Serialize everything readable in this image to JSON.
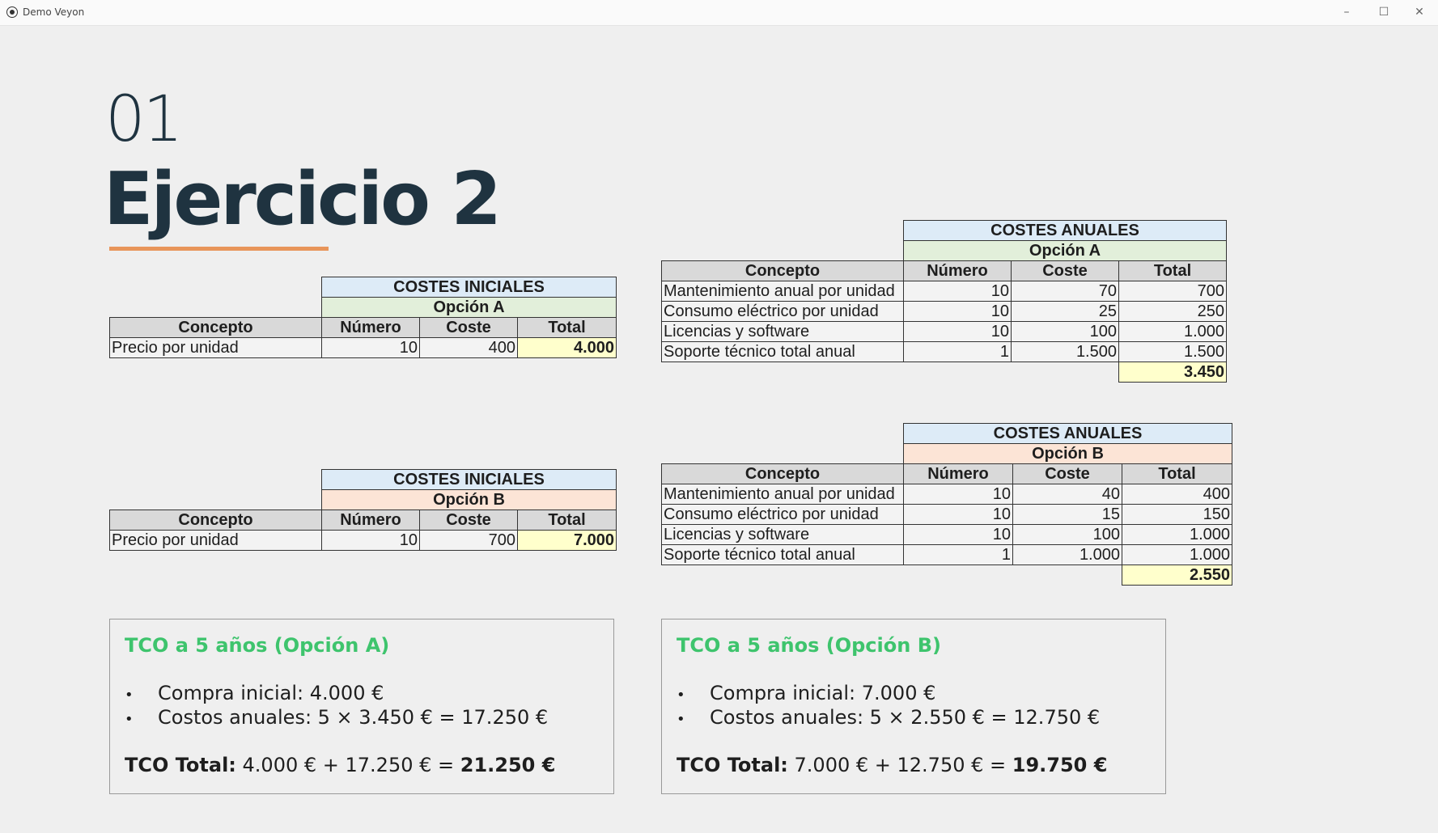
{
  "window": {
    "title": "Demo Veyon",
    "minimize": "–",
    "maximize": "☐",
    "close": "✕"
  },
  "slide": {
    "number": "01",
    "title": "Ejercicio 2"
  },
  "initial_a": {
    "heading": "COSTES INICIALES",
    "option": "Opción A",
    "columns": [
      "Concepto",
      "Número",
      "Coste",
      "Total"
    ],
    "rows": [
      {
        "concept": "Precio por unidad",
        "number": "10",
        "cost": "400",
        "total": "4.000"
      }
    ]
  },
  "initial_b": {
    "heading": "COSTES INICIALES",
    "option": "Opción B",
    "columns": [
      "Concepto",
      "Número",
      "Coste",
      "Total"
    ],
    "rows": [
      {
        "concept": "Precio por unidad",
        "number": "10",
        "cost": "700",
        "total": "7.000"
      }
    ]
  },
  "annual_a": {
    "heading": "COSTES ANUALES",
    "option": "Opción A",
    "columns": [
      "Concepto",
      "Número",
      "Coste",
      "Total"
    ],
    "rows": [
      {
        "concept": "Mantenimiento anual por unidad",
        "number": "10",
        "cost": "70",
        "total": "700"
      },
      {
        "concept": "Consumo eléctrico por unidad",
        "number": "10",
        "cost": "25",
        "total": "250"
      },
      {
        "concept": "Licencias y software",
        "number": "10",
        "cost": "100",
        "total": "1.000"
      },
      {
        "concept": "Soporte técnico total anual",
        "number": "1",
        "cost": "1.500",
        "total": "1.500"
      }
    ],
    "grand_total": "3.450"
  },
  "annual_b": {
    "heading": "COSTES ANUALES",
    "option": "Opción B",
    "columns": [
      "Concepto",
      "Número",
      "Coste",
      "Total"
    ],
    "rows": [
      {
        "concept": "Mantenimiento anual por unidad",
        "number": "10",
        "cost": "40",
        "total": "400"
      },
      {
        "concept": "Consumo eléctrico por unidad",
        "number": "10",
        "cost": "15",
        "total": "150"
      },
      {
        "concept": "Licencias y software",
        "number": "10",
        "cost": "100",
        "total": "1.000"
      },
      {
        "concept": "Soporte técnico total anual",
        "number": "1",
        "cost": "1.000",
        "total": "1.000"
      }
    ],
    "grand_total": "2.550"
  },
  "tco_a": {
    "title": "TCO a 5 años (Opción A)",
    "items": [
      "Compra inicial:  4.000 €",
      "Costos anuales: 5 × 3.450 € = 17.250 €"
    ],
    "total_label": "TCO Total:",
    "total_expr": " 4.000 € + 17.250 € = ",
    "total_value": "21.250 €"
  },
  "tco_b": {
    "title": "TCO a 5 años (Opción B)",
    "items": [
      "Compra inicial:  7.000 €",
      "Costos anuales: 5 × 2.550 € = 12.750 €"
    ],
    "total_label": "TCO Total:",
    "total_expr": " 7.000 € + 12.750 € = ",
    "total_value": "19.750 €"
  },
  "bullet_char": "•"
}
